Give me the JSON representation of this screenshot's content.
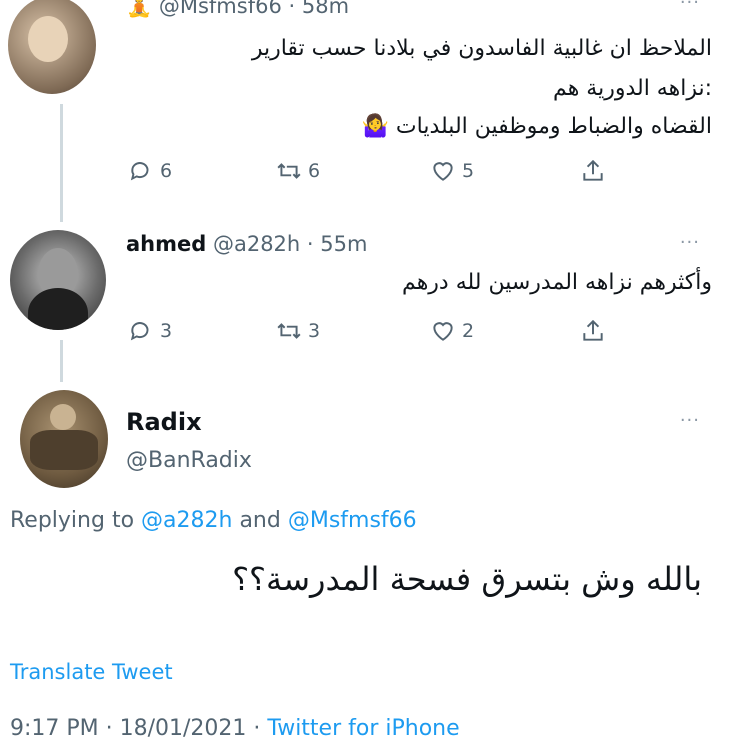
{
  "tweet1": {
    "emoji": "🧘",
    "handle": "@Msfmsf66",
    "time": "· 58m",
    "more": "···",
    "line1": "الملاحظ ان غالبية الفاسدون في بلادنا حسب تقارير",
    "line2": ":نزاهه الدورية هم",
    "line3": "القضاه والضباط وموظفين البلديات 🤷‍♀️",
    "replies": "6",
    "retweets": "6",
    "likes": "5"
  },
  "tweet2": {
    "name": "ahmed",
    "handle": "@a282h",
    "time": "· 55m",
    "more": "···",
    "text": "وأكثرهم نزاهه المدرسين لله درهم",
    "replies": "3",
    "retweets": "3",
    "likes": "2"
  },
  "main_tweet": {
    "name": "Radix",
    "handle": "@BanRadix",
    "more": "···",
    "replying_prefix": "Replying to ",
    "replying_user1": "@a282h",
    "replying_and": " and ",
    "replying_user2": "@Msfmsf66",
    "text": "بالله وش بتسرق فسحة المدرسة؟؟",
    "translate": "Translate Tweet",
    "timestamp": "9:17 PM · 18/01/2021 · ",
    "source": "Twitter for iPhone"
  },
  "colors": {
    "accent": "#1d9bf0",
    "secondary_text": "#536471",
    "primary_text": "#0f1419"
  }
}
